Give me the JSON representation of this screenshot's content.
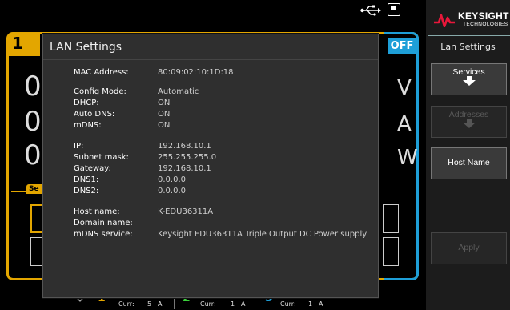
{
  "status_bar": {
    "icons": [
      "usb-icon",
      "drive-icon"
    ]
  },
  "brand": {
    "name": "KEYSIGHT",
    "sub": "TECHNOLOGIES",
    "accent": "#e8173a"
  },
  "soft_panel": {
    "title": "Lan Settings",
    "buttons": [
      {
        "label": "Services",
        "enabled": true
      },
      {
        "label": "Addresses",
        "enabled": false
      },
      {
        "label": "Host Name",
        "enabled": true
      },
      {
        "label": "Apply",
        "enabled": false
      }
    ]
  },
  "background": {
    "channel": "1",
    "off_label": "OFF",
    "digits": [
      "0",
      "0",
      "0"
    ],
    "units": [
      "V",
      "A",
      "W"
    ],
    "se_label": "Se"
  },
  "bottom_bar": {
    "channels": [
      {
        "num": "1",
        "curr_label": "Curr:",
        "value": "5",
        "unit": "A",
        "color": "#e3a600"
      },
      {
        "num": "2",
        "curr_label": "Curr:",
        "value": "1",
        "unit": "A",
        "color": "#3bd13b"
      },
      {
        "num": "3",
        "curr_label": "Curr:",
        "value": "1",
        "unit": "A",
        "color": "#1e9fd8"
      }
    ]
  },
  "dialog": {
    "title": "LAN Settings",
    "fields": {
      "mac_label": "MAC Address:",
      "mac_value": "80:09:02:10:1D:18",
      "config_label": "Config Mode:",
      "config_value": "Automatic",
      "dhcp_label": "DHCP:",
      "dhcp_value": "ON",
      "autodns_label": "Auto DNS:",
      "autodns_value": "ON",
      "mdns_label": "mDNS:",
      "mdns_value": "ON",
      "ip_label": "IP:",
      "ip_value": "192.168.10.1",
      "subnet_label": "Subnet mask:",
      "subnet_value": "255.255.255.0",
      "gateway_label": "Gateway:",
      "gateway_value": "192.168.10.1",
      "dns1_label": "DNS1:",
      "dns1_value": "0.0.0.0",
      "dns2_label": "DNS2:",
      "dns2_value": "0.0.0.0",
      "host_label": "Host name:",
      "host_value": "K-EDU36311A",
      "domain_label": "Domain name:",
      "domain_value": "",
      "mdnssvc_label": "mDNS service:",
      "mdnssvc_value": "Keysight EDU36311A Triple Output DC Power supply"
    }
  }
}
